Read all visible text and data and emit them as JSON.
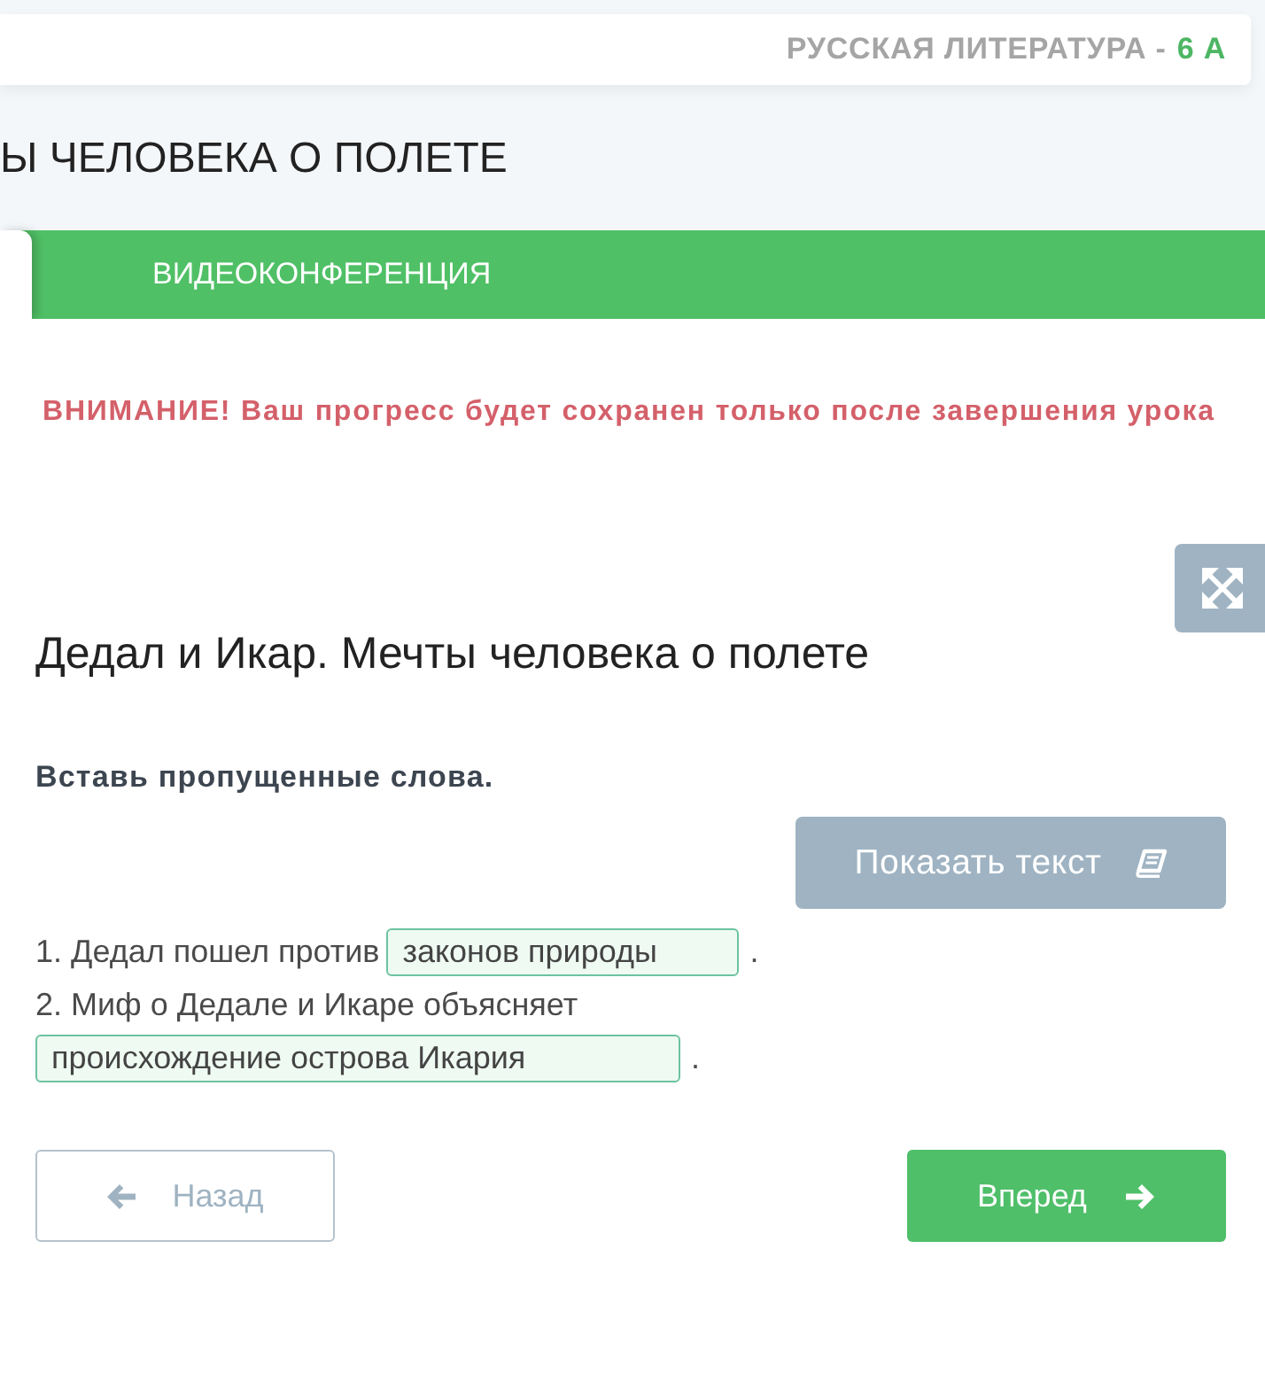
{
  "header": {
    "subject": "РУССКАЯ ЛИТЕРАТУРА -",
    "grade": "6 А"
  },
  "lesson_title": "Ы ЧЕЛОВЕКА О ПОЛЕТЕ",
  "tabs": [
    {
      "selected": true
    },
    {
      "label": "ВИДЕОКОНФЕРЕНЦИЯ",
      "selected": false
    }
  ],
  "warning": "ВНИМАНИЕ! Ваш прогресс будет сохранен только после завершения урока",
  "exercise": {
    "title": "Дедал и Икар. Мечты человека о полете",
    "instruction": "Вставь пропущенные слова.",
    "show_text_button": "Показать текст",
    "items": [
      {
        "text": "1. Дедал пошел против",
        "answer": "законов природы",
        "end": "."
      },
      {
        "text": "2. Миф о Дедале и Икаре объясняет",
        "answer": "происхождение острова Икария",
        "end": "."
      }
    ]
  },
  "nav": {
    "back": "Назад",
    "next": "Вперед"
  }
}
